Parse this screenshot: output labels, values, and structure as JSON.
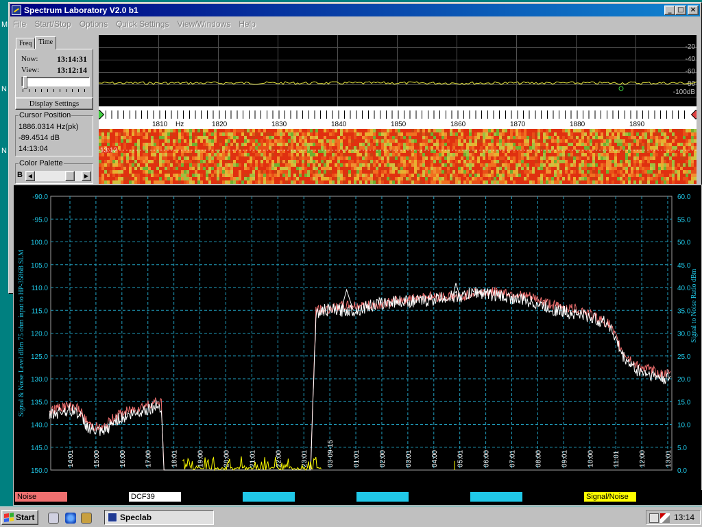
{
  "window": {
    "title": "Spectrum Laboratory V2.0 b1"
  },
  "title_buttons": {
    "minimize": "_",
    "maximize": "□",
    "close": "×"
  },
  "menu": [
    "File",
    "Start/Stop",
    "Options",
    "Quick Settings",
    "View/Windows",
    "Help"
  ],
  "tabs": [
    {
      "label": "Freq"
    },
    {
      "label": "Time"
    }
  ],
  "time_panel": {
    "now_label": "Now:",
    "now_value": "13:14:31",
    "view_label": "View:",
    "view_value": "13:12:14",
    "display_settings": "Display Settings"
  },
  "cursor_position": {
    "label": "Cursor Position",
    "freq": "1886.0314 Hz(pk)",
    "level": "-89.4514 dB",
    "time": "14:13:04"
  },
  "color_palette": {
    "label": "Color Palette",
    "b": "B",
    "left_arrow": "◀",
    "right_arrow": "▶"
  },
  "spectrum": {
    "db_labels": [
      "-20",
      "-40",
      "-60",
      "-80",
      "-100dB"
    ],
    "freq_labels": [
      "1810",
      "Hz",
      "1820",
      "1830",
      "1840",
      "1850",
      "1860",
      "1870",
      "1880",
      "1890"
    ],
    "waterfall_time": "13:12"
  },
  "chart_data": {
    "type": "line",
    "ylabel": "Signal & Noise Level  dBm 75 ohm input to HP-3586B SLM",
    "y2label": "Signal to Noise Ratio   dBm",
    "ylim": [
      -150,
      -90
    ],
    "y2lim": [
      0,
      60
    ],
    "yticks": [
      "-90.0",
      "-95.0",
      "100.0",
      "105.0",
      "110.0",
      "115.0",
      "120.0",
      "125.0",
      "130.0",
      "135.0",
      "140.0",
      "145.0",
      "150.0"
    ],
    "y2ticks": [
      "60.0",
      "55.0",
      "50.0",
      "45.0",
      "40.0",
      "35.0",
      "30.0",
      "25.0",
      "20.0",
      "15.0",
      "10.0",
      "5.0",
      "0.0"
    ],
    "xticks": [
      "14:01",
      "15:00",
      "16:00",
      "17:00",
      "18:01",
      "19:00",
      "20:00",
      "21:01",
      "22:00",
      "23:01",
      "03-09-15",
      "01:01",
      "02:00",
      "03:01",
      "04:00",
      "05:01",
      "06:00",
      "07:01",
      "08:00",
      "09:01",
      "10:00",
      "11:01",
      "12:00",
      "13:01"
    ],
    "grid": true,
    "series": [
      {
        "name": "Noise",
        "color": "#f07070"
      },
      {
        "name": "DCF39",
        "color": "#ffffff"
      },
      {
        "name": "Signal/Noise",
        "color": "#ffff00"
      }
    ],
    "approx_level_profile": {
      "hours": [
        0,
        0.5,
        1,
        1.5,
        2,
        2.5,
        3,
        3.5,
        4,
        4.2,
        4.3,
        5,
        6,
        7,
        8,
        9,
        9.8,
        10,
        10.3,
        11,
        11.5,
        12,
        13,
        14,
        15,
        15.5,
        16,
        17,
        18,
        19,
        20,
        21,
        21.5,
        22,
        22.5,
        23,
        23.3
      ],
      "dcf39_dbm": [
        -138,
        -137,
        -137,
        -141,
        -142,
        -139,
        -138,
        -137,
        -136,
        -136,
        -150,
        -150,
        -150,
        -150,
        -150,
        -150,
        -150,
        -116,
        -115,
        -115,
        -115,
        -114,
        -113,
        -113,
        -112,
        -112,
        -111,
        -112,
        -113,
        -115,
        -116,
        -118,
        -125,
        -128,
        -129,
        -130,
        -130
      ],
      "noise_dbm": [
        -137,
        -136,
        -136,
        -140,
        -141,
        -138,
        -137,
        -136,
        -135,
        -135,
        -150,
        -150,
        -150,
        -150,
        -150,
        -150,
        -150,
        -115,
        -115,
        -114,
        -114,
        -114,
        -113,
        -112,
        -112,
        -112,
        -111,
        -111,
        -112,
        -114,
        -115,
        -118,
        -124,
        -127,
        -128,
        -129,
        -129
      ]
    }
  },
  "legend": [
    {
      "label": "Noise",
      "bg": "#f07070",
      "fg": "#000000"
    },
    {
      "label": "DCF39",
      "bg": "#ffffff",
      "fg": "#000000"
    },
    {
      "label": "",
      "bg": "#20c8e8",
      "fg": "#000000"
    },
    {
      "label": "",
      "bg": "#20c8e8",
      "fg": "#000000"
    },
    {
      "label": "",
      "bg": "#20c8e8",
      "fg": "#000000"
    },
    {
      "label": "Signal/Noise",
      "bg": "#ffff00",
      "fg": "#000000"
    }
  ],
  "taskbar": {
    "start": "Start",
    "task": "Speclab",
    "clock": "13:14"
  },
  "desktop_letters": [
    "M",
    "N",
    "N"
  ]
}
